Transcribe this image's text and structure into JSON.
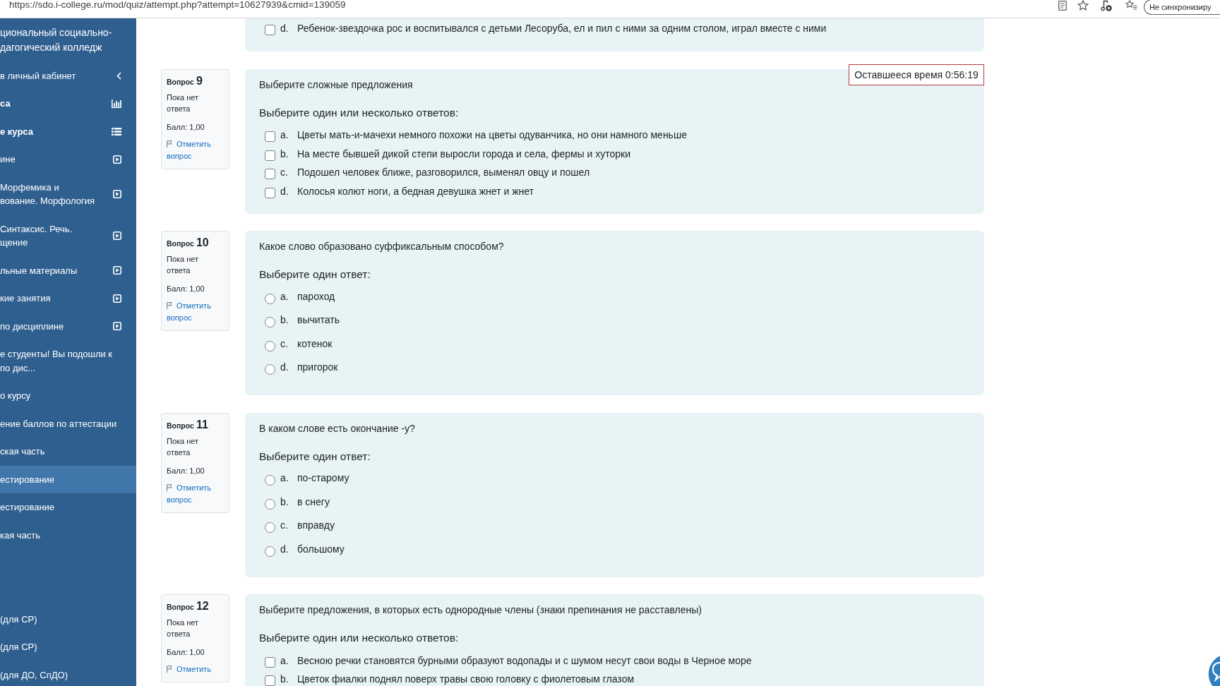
{
  "browser": {
    "url": "https://sdo.i-college.ru/mod/quiz/attempt.php?attempt=10627939&cmid=139059",
    "sync_button": "Не синхронизиру"
  },
  "sidebar": {
    "title_lines": [
      "циональный социально-",
      "дагогический колледж"
    ],
    "items": [
      {
        "lines": [
          "в личный кабинет"
        ],
        "kind": "back",
        "selected": false
      },
      {
        "lines": [
          "са"
        ],
        "kind": "report",
        "selected": false
      },
      {
        "lines": [
          "е курса"
        ],
        "kind": "index",
        "selected": false
      },
      {
        "lines": [
          "ине"
        ],
        "kind": "section",
        "selected": false
      },
      {
        "lines": [
          "Морфемика и",
          "вование. Морфология"
        ],
        "kind": "section",
        "selected": false
      },
      {
        "lines": [
          "Синтаксис. Речь.",
          "щение"
        ],
        "kind": "section",
        "selected": false
      },
      {
        "lines": [
          "льные материалы"
        ],
        "kind": "section",
        "selected": false
      },
      {
        "lines": [
          "кие занятия"
        ],
        "kind": "section",
        "selected": false
      },
      {
        "lines": [
          "по дисциплине"
        ],
        "kind": "section",
        "selected": false
      },
      {
        "lines": [
          "е студенты! Вы подошли к",
          "по дис..."
        ],
        "kind": "link",
        "selected": false
      },
      {
        "lines": [
          "о курсу"
        ],
        "kind": "link",
        "selected": false
      },
      {
        "lines": [
          "ение баллов по аттестации"
        ],
        "kind": "link",
        "selected": false
      },
      {
        "lines": [
          "ская часть"
        ],
        "kind": "link",
        "selected": false
      },
      {
        "lines": [
          "естирование"
        ],
        "kind": "link",
        "selected": true
      },
      {
        "lines": [
          "естирование"
        ],
        "kind": "link",
        "selected": false
      },
      {
        "lines": [
          "кая часть"
        ],
        "kind": "link",
        "selected": false
      },
      {
        "lines": [
          "(для СР)"
        ],
        "kind": "link",
        "selected": false
      },
      {
        "lines": [
          "(для СР)"
        ],
        "kind": "link",
        "selected": false
      },
      {
        "lines": [
          "(для ДО, СпДО)"
        ],
        "kind": "link",
        "selected": false
      }
    ]
  },
  "timer": "Оставшееся время 0:56:19",
  "previous_question_tail": {
    "kind": "checkbox",
    "options": [
      {
        "letter": "d.",
        "text": "Ребенок-звездочка рос и воспитывался с детьми Лесоруба, ел и пил с ними за одним столом, играл вместе с ними",
        "checked": false
      }
    ]
  },
  "questions": [
    {
      "label": "Вопрос",
      "number": "9",
      "status": "Пока нет ответа",
      "mark": "Балл: 1,00",
      "flag_link": "Отметить вопрос",
      "text": "Выберите сложные предложения",
      "prompt": "Выберите один или несколько ответов:",
      "kind": "checkbox",
      "options": [
        {
          "letter": "a.",
          "text": "Цветы мать-и-мачехи немного похожи на цветы одуванчика, но они намного меньше",
          "checked": false
        },
        {
          "letter": "b.",
          "text": "На месте бывшей дикой степи выросли города и села, фермы и хуторки",
          "checked": false
        },
        {
          "letter": "c.",
          "text": "Подошел человек ближе, разговорился, выменял овцу и пошел",
          "checked": false
        },
        {
          "letter": "d.",
          "text": "Колосья колют ноги, а бедная девушка жнет и жнет",
          "checked": false
        }
      ]
    },
    {
      "label": "Вопрос",
      "number": "10",
      "status": "Пока нет ответа",
      "mark": "Балл: 1,00",
      "flag_link": "Отметить вопрос",
      "text": "Какое слово образовано суффиксальным способом?",
      "prompt": "Выберите один ответ:",
      "kind": "radio",
      "options": [
        {
          "letter": "a.",
          "text": "пароход",
          "selected": false
        },
        {
          "letter": "b.",
          "text": "вычитать",
          "selected": false
        },
        {
          "letter": "c.",
          "text": "котенок",
          "selected": false
        },
        {
          "letter": "d.",
          "text": "пригорок",
          "selected": false
        }
      ]
    },
    {
      "label": "Вопрос",
      "number": "11",
      "status": "Пока нет ответа",
      "mark": "Балл: 1,00",
      "flag_link": "Отметить вопрос",
      "text": "В каком слове есть окончание -у?",
      "prompt": "Выберите один ответ:",
      "kind": "radio",
      "options": [
        {
          "letter": "a.",
          "text": "по-старому",
          "selected": false
        },
        {
          "letter": "b.",
          "text": "в снегу",
          "selected": false
        },
        {
          "letter": "c.",
          "text": "вправду",
          "selected": false
        },
        {
          "letter": "d.",
          "text": "большому",
          "selected": false
        }
      ]
    },
    {
      "label": "Вопрос",
      "number": "12",
      "status": "Пока нет ответа",
      "mark": "Балл: 1,00",
      "flag_link": "Отметить",
      "text": "Выберите предложения, в которых есть однородные члены (знаки препинания не расставлены)",
      "prompt": "Выберите один или несколько ответов:",
      "kind": "checkbox",
      "options": [
        {
          "letter": "a.",
          "text": "Весною речки становятся бурными образуют водопады и с шумом несут свои воды в Черное море",
          "checked": false
        },
        {
          "letter": "b.",
          "text": "Цветок фиалки поднял поверх травы свою головку с фиолетовым глазом",
          "checked": false
        }
      ]
    }
  ]
}
